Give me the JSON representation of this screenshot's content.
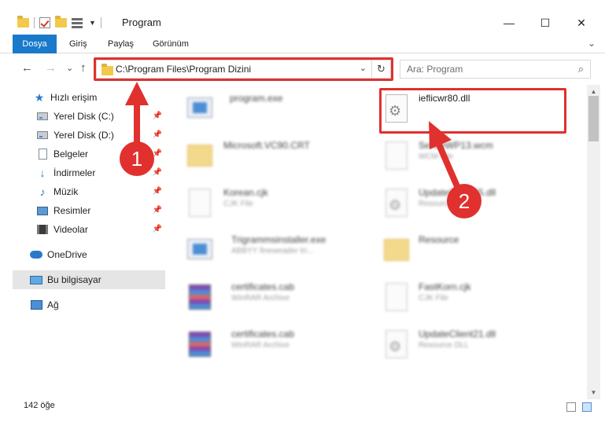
{
  "window": {
    "title": "Program",
    "minimize": "—",
    "maximize": "☐",
    "close": "✕"
  },
  "ribbon": {
    "tabs": [
      "Dosya",
      "Giriş",
      "Paylaş",
      "Görünüm"
    ],
    "expand": "⌄"
  },
  "nav": {
    "back": "←",
    "forward": "→",
    "recent": "⌄",
    "up": "↑"
  },
  "address": {
    "path": "C:\\Program Files\\Program Dizini",
    "dropdown": "⌄",
    "refresh": "↻"
  },
  "search": {
    "placeholder": "Ara: Program"
  },
  "sidebar": {
    "items": [
      {
        "label": "Hızlı erişim",
        "icon": "star-icon"
      },
      {
        "label": "Yerel Disk (C:)",
        "icon": "drive-icon",
        "pinned": true
      },
      {
        "label": "Yerel Disk (D:)",
        "icon": "drive-icon",
        "pinned": true
      },
      {
        "label": "Belgeler",
        "icon": "document-icon",
        "pinned": true
      },
      {
        "label": "İndirmeler",
        "icon": "download-icon",
        "pinned": true
      },
      {
        "label": "Müzik",
        "icon": "music-icon",
        "pinned": true
      },
      {
        "label": "Resimler",
        "icon": "pictures-icon",
        "pinned": true
      },
      {
        "label": "Videolar",
        "icon": "video-icon",
        "pinned": true
      },
      {
        "label": "OneDrive",
        "icon": "cloud-icon"
      },
      {
        "label": "Bu bilgisayar",
        "icon": "computer-icon",
        "selected": true
      },
      {
        "label": "Ağ",
        "icon": "network-icon"
      }
    ],
    "pin_glyph": "📌"
  },
  "files": [
    {
      "name": "program.exe",
      "sub": "",
      "icon": "exe-icon",
      "blurred": true
    },
    {
      "name": "ieflicwr80.dll",
      "sub": "",
      "icon": "dll-gear-icon",
      "blurred": false
    },
    {
      "name": "Microsoft.VC90.CRT",
      "sub": "",
      "icon": "folder-icon",
      "blurred": true
    },
    {
      "name": "SenseWP13.wcm",
      "sub": "WCM File",
      "icon": "file-icon",
      "blurred": true
    },
    {
      "name": "Korean.cjk",
      "sub": "CJK File",
      "icon": "file-icon",
      "blurred": true
    },
    {
      "name": "UpdateClient65.dll",
      "sub": "Resource DLL",
      "icon": "dll-gear-icon",
      "blurred": true
    },
    {
      "name": "Trigrammsinstaller.exe",
      "sub": "ABBYY fineweader tri...",
      "icon": "exe-icon",
      "blurred": true
    },
    {
      "name": "Resource",
      "sub": "",
      "icon": "folder-icon",
      "blurred": true
    },
    {
      "name": "certificates.cab",
      "sub": "WinRAR Archive",
      "icon": "rar-icon",
      "blurred": true
    },
    {
      "name": "FastKorn.cjk",
      "sub": "CJK File",
      "icon": "file-icon",
      "blurred": true
    },
    {
      "name": "certificates.cab",
      "sub": "WinRAR Archive",
      "icon": "rar-icon",
      "blurred": true
    },
    {
      "name": "UpdateClient21.dll",
      "sub": "Resource DLL",
      "icon": "dll-gear-icon",
      "blurred": true
    }
  ],
  "status": {
    "count": "142 öğe"
  },
  "annotations": {
    "step1": "1",
    "step2": "2",
    "color": "#e0312e"
  }
}
